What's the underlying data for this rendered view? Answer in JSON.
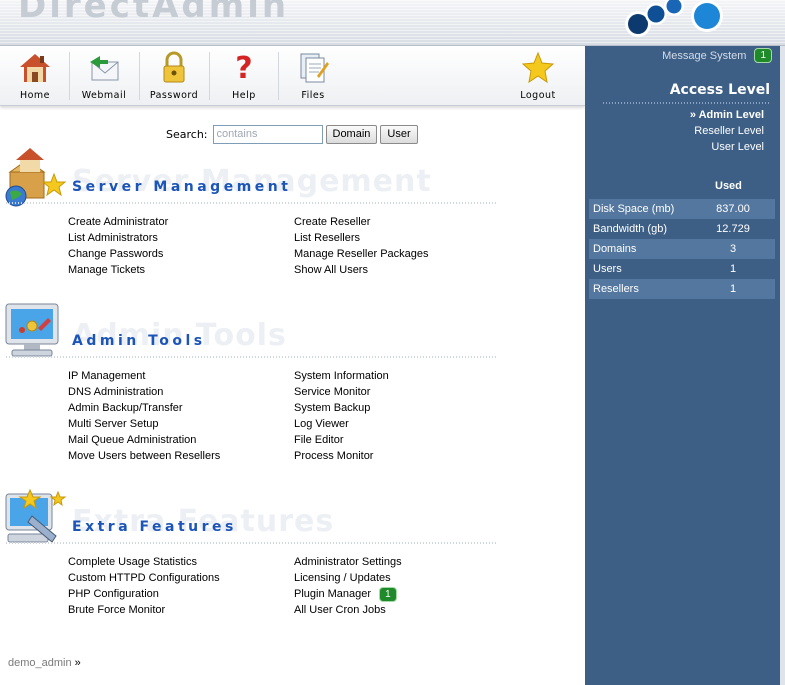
{
  "toolbar": {
    "items": [
      {
        "label": "Home",
        "icon": "house-icon"
      },
      {
        "label": "Webmail",
        "icon": "mail-icon"
      },
      {
        "label": "Password",
        "icon": "padlock-icon"
      },
      {
        "label": "Help",
        "icon": "question-mark-icon"
      },
      {
        "label": "Files",
        "icon": "files-icon"
      },
      {
        "label": "Logout",
        "icon": "star-icon"
      }
    ]
  },
  "search": {
    "label": "Search:",
    "placeholder": "contains",
    "domain_button": "Domain",
    "user_button": "User"
  },
  "sections": [
    {
      "title": "Server Management",
      "icon": "server-management-icon",
      "left": [
        "Create Administrator",
        "List Administrators",
        "Change Passwords",
        "Manage Tickets"
      ],
      "right": [
        "Create Reseller",
        "List Resellers",
        "Manage Reseller Packages",
        "Show All Users"
      ]
    },
    {
      "title": "Admin Tools",
      "icon": "monitor-tools-icon",
      "left": [
        "IP Management",
        "DNS Administration",
        "Admin Backup/Transfer",
        "Multi Server Setup",
        "Mail Queue Administration",
        "Move Users between Resellers"
      ],
      "right": [
        "System Information",
        "Service Monitor",
        "System Backup",
        "Log Viewer",
        "File Editor",
        "Process Monitor"
      ]
    },
    {
      "title": "Extra Features",
      "icon": "extra-features-icon",
      "left": [
        "Complete Usage Statistics",
        "Custom HTTPD Configurations",
        "PHP Configuration",
        "Brute Force Monitor"
      ],
      "right": [
        "Administrator Settings",
        "Licensing / Updates",
        "Plugin Manager",
        "All User Cron Jobs"
      ],
      "plugin_badge": "1"
    }
  ],
  "footer": {
    "user": "demo_admin",
    "arrow": "»"
  },
  "panel": {
    "message_system": "Message System",
    "message_count": "1",
    "access_title": "Access Level",
    "levels": [
      "» Admin Level",
      "Reseller Level",
      "User Level"
    ],
    "used_header": "Used",
    "stats": [
      {
        "label": "Disk Space (mb)",
        "value": "837.00"
      },
      {
        "label": "Bandwidth (gb)",
        "value": "12.729"
      },
      {
        "label": "Domains",
        "value": "3"
      },
      {
        "label": "Users",
        "value": "1"
      },
      {
        "label": "Resellers",
        "value": "1"
      }
    ]
  },
  "colors": {
    "panel_bg": "#3d5f85",
    "panel_row_alt": "#54779f",
    "section_title": "#1c55b8",
    "badge_green": "#1f8a2a"
  }
}
